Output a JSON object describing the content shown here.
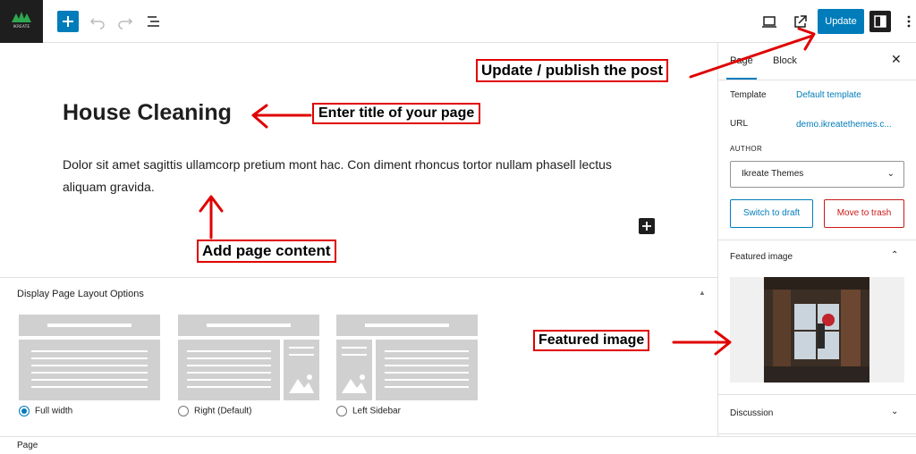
{
  "logo": {
    "text": "IKREATE"
  },
  "toolbar": {
    "update_label": "Update"
  },
  "editor": {
    "title": "House Cleaning",
    "paragraph": "Dolor sit amet sagittis ullamcorp pretium mont hac. Con diment rhoncus tortor nullam phasell lectus aliquam gravida."
  },
  "metabox": {
    "title": "Display Page Layout Options",
    "options": [
      {
        "label": "Full width",
        "checked": true
      },
      {
        "label": "Right (Default)",
        "checked": false
      },
      {
        "label": "Left Sidebar",
        "checked": false
      }
    ]
  },
  "footer": {
    "breadcrumb": "Page"
  },
  "sidebar": {
    "tabs": [
      "Page",
      "Block"
    ],
    "template_label": "Template",
    "template_value": "Default template",
    "url_label": "URL",
    "url_value": "demo.ikreatethemes.c...",
    "author_label": "AUTHOR",
    "author_value": "Ikreate Themes",
    "switch_draft": "Switch to draft",
    "move_trash": "Move to trash",
    "featured_title": "Featured image",
    "discussion_title": "Discussion"
  },
  "annotations": {
    "update": "Update / publish the post",
    "title": "Enter title of your page",
    "content": "Add page content",
    "featured": "Featured image"
  },
  "colors": {
    "accent": "#007cba",
    "danger": "#cc1818",
    "annotation": "#e00000"
  }
}
